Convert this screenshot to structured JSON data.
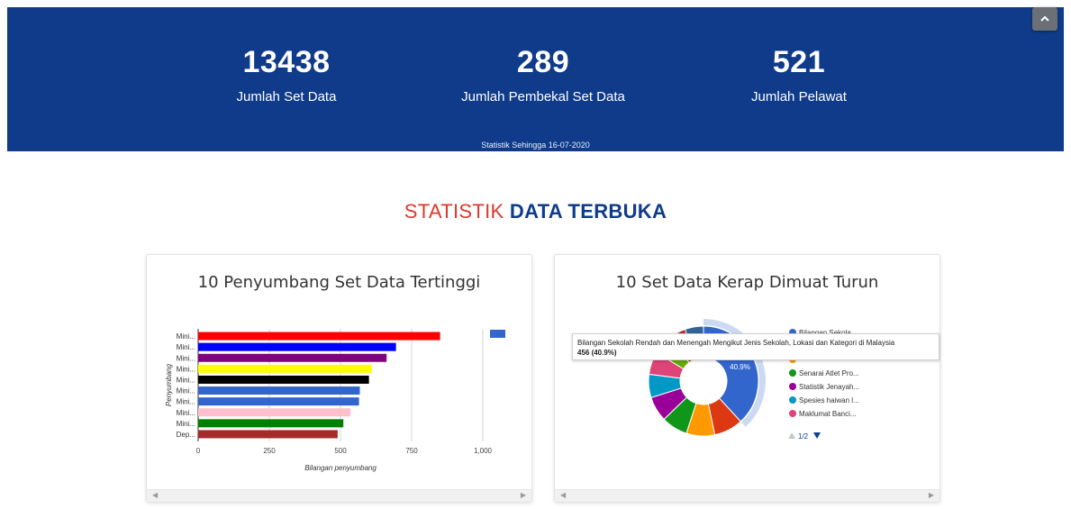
{
  "banner": {
    "stats": [
      {
        "value": "13438",
        "label": "Jumlah Set Data"
      },
      {
        "value": "289",
        "label": "Jumlah Pembekal Set Data"
      },
      {
        "value": "521",
        "label": "Jumlah Pelawat"
      }
    ],
    "as_of": "Statistik Sehingga 16-07-2020",
    "scroll_up_icon": "chevron-up-icon"
  },
  "heading": {
    "part1": "STATISTIK",
    "part2": "DATA TERBUKA"
  },
  "chart_data": [
    {
      "type": "bar",
      "orientation": "horizontal",
      "title": "10 Penyumbang Set Data Tertinggi",
      "xlabel": "Bilangan penyumbang",
      "ylabel": "Penyumbang",
      "categories": [
        "Mini...",
        "Mini...",
        "Mini...",
        "Mini...",
        "Mini...",
        "Mini...",
        "Mini...",
        "Mini...",
        "Mini...",
        "Dep..."
      ],
      "values": [
        850,
        695,
        662,
        610,
        600,
        568,
        565,
        535,
        510,
        490
      ],
      "colors": [
        "#ff0000",
        "#0000ff",
        "#800080",
        "#ffff00",
        "#000000",
        "#3366cc",
        "#3366cc",
        "#ffc0cb",
        "#008000",
        "#a52a2a"
      ],
      "xlim": [
        0,
        1000
      ],
      "xticks": [
        "0",
        "250",
        "500",
        "750",
        "1,000"
      ],
      "legend_color": "#3366cc",
      "grid": true
    },
    {
      "type": "pie",
      "donut": true,
      "title": "10 Set Data Kerap Dimuat Turun",
      "slices": [
        {
          "label": "Bilangan Sekolah Rendah dan Menengah Mengikut Jenis Sekolah, Lokasi dan Kategori di Malaysia",
          "value": 456,
          "percent": 40.9,
          "color": "#3366cc"
        },
        {
          "label": "",
          "value": 102,
          "color": "#dc3912"
        },
        {
          "label": "",
          "value": 100,
          "color": "#ff9900"
        },
        {
          "label": "Senarai Atlet Pro...",
          "value": 92,
          "color": "#109618"
        },
        {
          "label": "Statistik Jenayah...",
          "value": 88,
          "color": "#990099"
        },
        {
          "label": "Spesies haiwan l...",
          "value": 82,
          "color": "#0099c6"
        },
        {
          "label": "Maklumat Banci...",
          "value": 80,
          "color": "#dd4477"
        },
        {
          "label": "",
          "value": 70,
          "color": "#66aa00"
        },
        {
          "label": "",
          "value": 60,
          "color": "#b82e2e"
        },
        {
          "label": "",
          "value": 65,
          "color": "#316395"
        }
      ],
      "legend_visible": [
        {
          "label": "Bilangan Sekola...",
          "color": "#3366cc"
        },
        {
          "label": "",
          "color": "#dc3912"
        },
        {
          "label": "",
          "color": "#ff9900"
        },
        {
          "label": "Senarai Atlet Pro...",
          "color": "#109618"
        },
        {
          "label": "Statistik Jenayah...",
          "color": "#990099"
        },
        {
          "label": "Spesies haiwan l...",
          "color": "#0099c6"
        },
        {
          "label": "Maklumat Banci...",
          "color": "#dd4477"
        }
      ],
      "pager": "1/2",
      "tooltip": {
        "title": "Bilangan Sekolah Rendah dan Menengah Mengikut Jenis Sekolah, Lokasi dan Kategori di Malaysia",
        "value": "456 (40.9%)"
      },
      "slice_label": "40.9%"
    }
  ]
}
